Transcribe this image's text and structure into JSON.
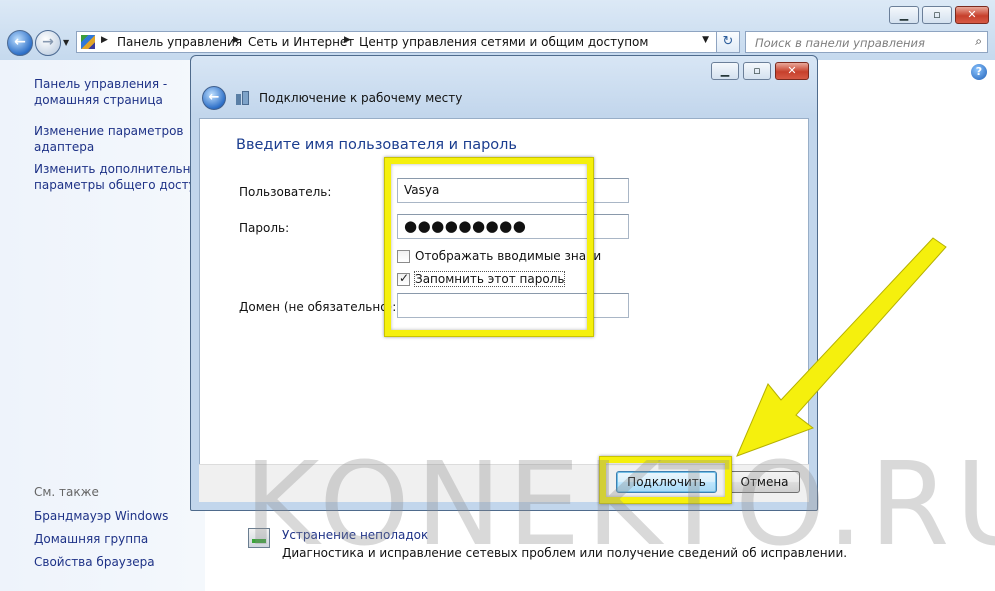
{
  "window": {
    "minimize": "▁",
    "maximize": "▫",
    "close": "✕"
  },
  "nav": {
    "back_glyph": "←",
    "forward_glyph": "→",
    "dropdown_glyph": "▼"
  },
  "address": {
    "crumbs": [
      "Панель управления",
      "Сеть и Интернет",
      "Центр управления сетями и общим доступом"
    ],
    "separator": "▶",
    "dropdown_glyph": "▼",
    "refresh_glyph": "↻"
  },
  "search": {
    "placeholder": "Поиск в панели управления",
    "icon_glyph": "⌕"
  },
  "sidebar": {
    "links": [
      {
        "label": "Панель управления -\nдомашняя страница"
      },
      {
        "label": "Изменение параметров\nадаптера"
      },
      {
        "label": "Изменить дополнительные\nпараметры общего доступа"
      }
    ],
    "see_also_heading": "См. также",
    "see_also": [
      "Брандмауэр Windows",
      "Домашняя группа",
      "Свойства браузера"
    ]
  },
  "help_glyph": "?",
  "troubleshoot": {
    "link": "Устранение неполадок",
    "description": "Диагностика и исправление сетевых проблем или получение сведений об исправлении."
  },
  "dialog": {
    "title": "Подключение к рабочему месту",
    "back_glyph": "←",
    "heading": "Введите имя пользователя и пароль",
    "user_label": "Пользователь:",
    "user_value": "Vasya",
    "password_label": "Пароль:",
    "password_value": "●●●●●●●●●",
    "show_chars_label": "Отображать вводимые знаки",
    "show_chars_checked": false,
    "remember_label": "Запомнить этот пароль",
    "remember_checked": true,
    "check_glyph": "✓",
    "domain_label": "Домен (не обязательно):",
    "domain_value": "",
    "connect_label": "Подключить",
    "cancel_label": "Отмена"
  },
  "annotation": {
    "highlight_color": "#f5f00d"
  },
  "watermark": "KONEKTO.RU"
}
